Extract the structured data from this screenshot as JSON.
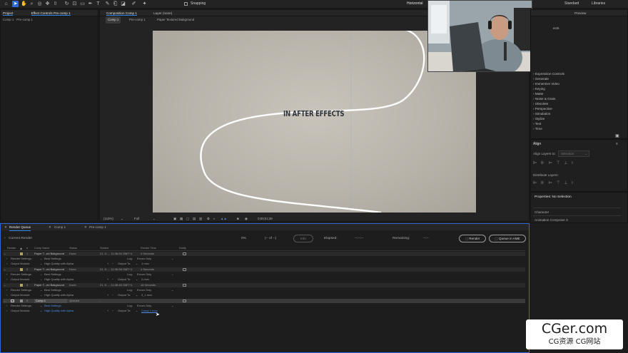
{
  "app": {
    "workspaces": [
      "Horizontal",
      "Standard",
      "Libraries"
    ],
    "snapping_label": "Snapping"
  },
  "project_panel": {
    "title": "Project",
    "subtitle": "Comp 1 · Pre-comp 1"
  },
  "effect_controls": {
    "title": "Effect Controls Pre-comp 1"
  },
  "composition_panel": {
    "title": "Composition Comp 1",
    "layer_tab": "Layer (none)",
    "breadcrumbs": [
      "Comp 1",
      "Pre-comp 1",
      "Paper Textured Bakground"
    ],
    "canvas_text": "IN AFTER EFFECTS",
    "zoom": "(110%)",
    "resolution": "Full",
    "timecode": "0;00;01;39"
  },
  "right_panel": {
    "preview_tab": "Preview",
    "presets_label": "ects",
    "effect_categories": [
      "Expression Controls",
      "Generate",
      "Immersive Video",
      "Keying",
      "Matte",
      "Noise & Grain",
      "Obsolete",
      "Perspective",
      "Simulation",
      "Stylize",
      "Text",
      "Time"
    ],
    "align_title": "Align",
    "align_layers_to_label": "Align Layers to:",
    "align_layers_to_value": "Selection",
    "distribute_label": "Distribute Layers:",
    "properties_title": "Properties: No Selection",
    "properties_items": [
      "Character",
      "Animation Composer 3"
    ]
  },
  "render_queue": {
    "tabs": [
      "Render Queue",
      "Comp 1",
      "Pre-comp 1"
    ],
    "current_render_label": "Current Render",
    "progress_percent": "0%",
    "of_label": "(-- of --)",
    "info_btn": "Info",
    "elapsed_label": "Elapsed:",
    "elapsed_value": "--:--:--",
    "remaining_label": "Remaining:",
    "remaining_value": "--:--",
    "render_btn": "Render",
    "ame_btn": "Queue in AME",
    "columns": [
      "Render",
      "#",
      "Comp Name",
      "Status",
      "Started",
      "Render Time",
      "Notify"
    ],
    "items": [
      {
        "num": "1",
        "name": "Paper T...ed Bakground",
        "status": "Done",
        "started": "21. 5. ... 11:36:54 GMT+1",
        "time": "4 Seconds",
        "settings": "Best Settings",
        "log": "Errors Only",
        "module": "High Quality with Alpha",
        "output": "1.mov"
      },
      {
        "num": "2",
        "name": "Paper T...ed Bakground",
        "status": "Done",
        "started": "21. 5. ... 11:36:58 GMT+1",
        "time": "4 Seconds",
        "settings": "Best Settings",
        "log": "Errors Only",
        "module": "High Quality with Alpha",
        "output": "2.mov"
      },
      {
        "num": "3",
        "name": "Paper T...ed Bakground",
        "status": "Done",
        "started": "21. 5. ... 11:38:46 GMT+1",
        "time": "16 Seconds",
        "settings": "Best Settings",
        "log": "Errors Only",
        "module": "High Quality with Alpha",
        "output": "3_1.mov"
      },
      {
        "num": "4",
        "name": "Comp 1",
        "status": "Queued",
        "started": "-",
        "time": "",
        "settings": "Best Settings",
        "log": "Errors Only",
        "module": "High Quality with Alpha",
        "output": "Comp 1.mov"
      }
    ],
    "render_settings_label": "Render Settings:",
    "output_module_label": "Output Module:",
    "log_label": "Log:",
    "output_to_label": "Output To:"
  },
  "watermark": {
    "main": "CGer.com",
    "sub": "CG资源 CG网站"
  }
}
